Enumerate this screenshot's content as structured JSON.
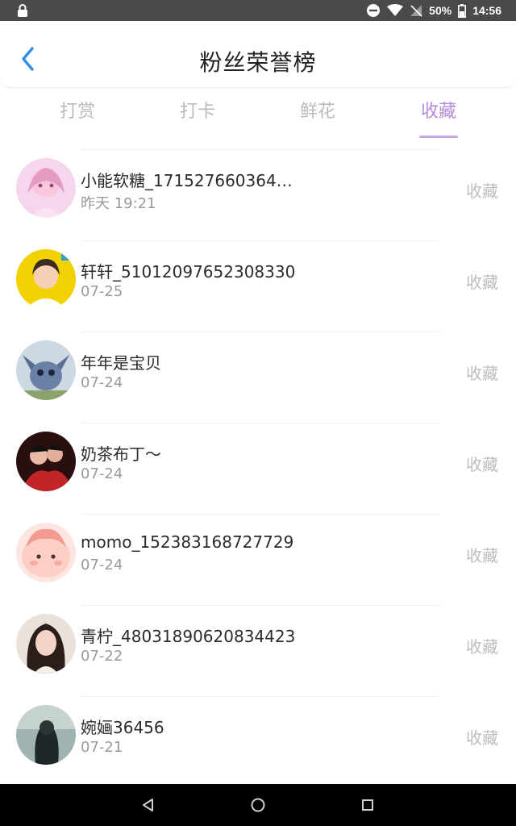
{
  "status_bar": {
    "battery": "50%",
    "time": "14:56"
  },
  "header": {
    "title": "粉丝荣誉榜"
  },
  "tabs": [
    {
      "label": "打赏",
      "active": false
    },
    {
      "label": "打卡",
      "active": false
    },
    {
      "label": "鲜花",
      "active": false
    },
    {
      "label": "收藏",
      "active": true
    }
  ],
  "fans": [
    {
      "name": "小能软糖_1715276603642...",
      "date": "昨天 19:21",
      "action": "收藏"
    },
    {
      "name": "轩轩_51012097652308330",
      "date": "07-25",
      "action": "收藏"
    },
    {
      "name": "年年是宝贝",
      "date": "07-24",
      "action": "收藏"
    },
    {
      "name": "奶茶布丁～",
      "date": "07-24",
      "action": "收藏"
    },
    {
      "name": "momo_152383168727729",
      "date": "07-24",
      "action": "收藏"
    },
    {
      "name": "青柠_48031890620834423",
      "date": "07-22",
      "action": "收藏"
    },
    {
      "name": "婉婳36456",
      "date": "07-21",
      "action": "收藏"
    }
  ],
  "colors": {
    "accent": "#b58ad9",
    "back_arrow": "#2f8fe8",
    "inactive_tab": "#bbbbbb"
  }
}
